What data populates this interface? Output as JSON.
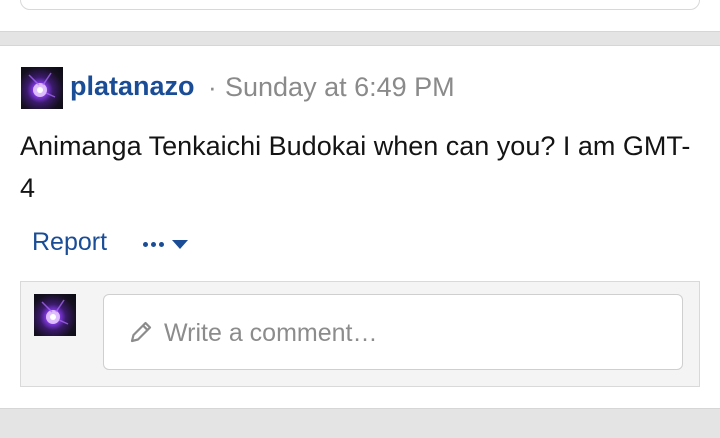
{
  "post": {
    "author": "platanazo",
    "separator": "·",
    "timestamp": "Sunday at 6:49 PM",
    "body": "Animanga Tenkaichi Budokai when can you? I am GMT-4",
    "actions": {
      "report_label": "Report",
      "more_icon": "ellipsis-icon",
      "caret_icon": "caret-down-icon"
    }
  },
  "comment": {
    "placeholder": "Write a comment…",
    "icon": "pencil-icon"
  },
  "colors": {
    "link": "#1a4d96",
    "muted": "#8a8a8a",
    "text": "#141414",
    "page_bg": "#e4e4e4"
  }
}
